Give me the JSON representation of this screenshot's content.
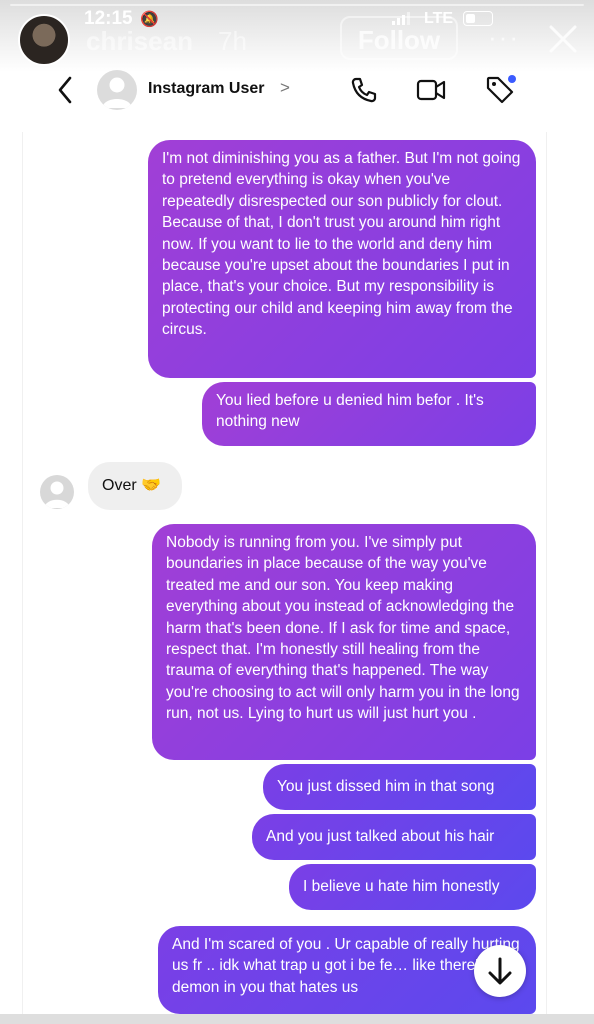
{
  "story": {
    "time": "12:15",
    "network": "LTE",
    "username": "chrisean",
    "age": "7h",
    "follow_label": "Follow",
    "more_label": "···"
  },
  "dm": {
    "contact_name": "Instagram User",
    "chevron": ">"
  },
  "messages": [
    {
      "from": "me",
      "text": "I'm not diminishing you as a father. But I'm not going to pretend everything is okay when you've repeatedly disrespected our son publicly for clout. Because of that, I don't trust you around him right now. If you want to lie to the world and deny him because you're upset about the boundaries I put in place, that's your choice. But my responsibility is protecting our child and keeping him away from the circus."
    },
    {
      "from": "me",
      "text": "You lied before u denied him befor . It's nothing new"
    },
    {
      "from": "them",
      "text": "Over 🤝"
    },
    {
      "from": "me",
      "text": "Nobody is running from you. I've simply put boundaries in place because of the way you've treated me and our son. You keep making everything about you instead of acknowledging the harm that's been done. If I ask for time and space, respect that. I'm honestly still healing from the trauma of everything that's happened. The way you're choosing to act will only harm you in the long run, not us. Lying to hurt us will just hurt you ."
    },
    {
      "from": "me",
      "text": "You just dissed him in that song"
    },
    {
      "from": "me",
      "text": "And you just talked about his hair"
    },
    {
      "from": "me",
      "text": "I believe u hate him honestly"
    },
    {
      "from": "me",
      "text": "And I'm scared of you . Ur capable of really hurting us fr .. idk what trap u got i be fe… like there's a demon in you that hates us"
    }
  ],
  "colors": {
    "bubble_top": "#a13fd6",
    "bubble_mid": "#7b3fe6",
    "bubble_bottom": "#5b49ee",
    "incoming_bg": "#efefef",
    "accent_dot": "#3b5bff"
  }
}
